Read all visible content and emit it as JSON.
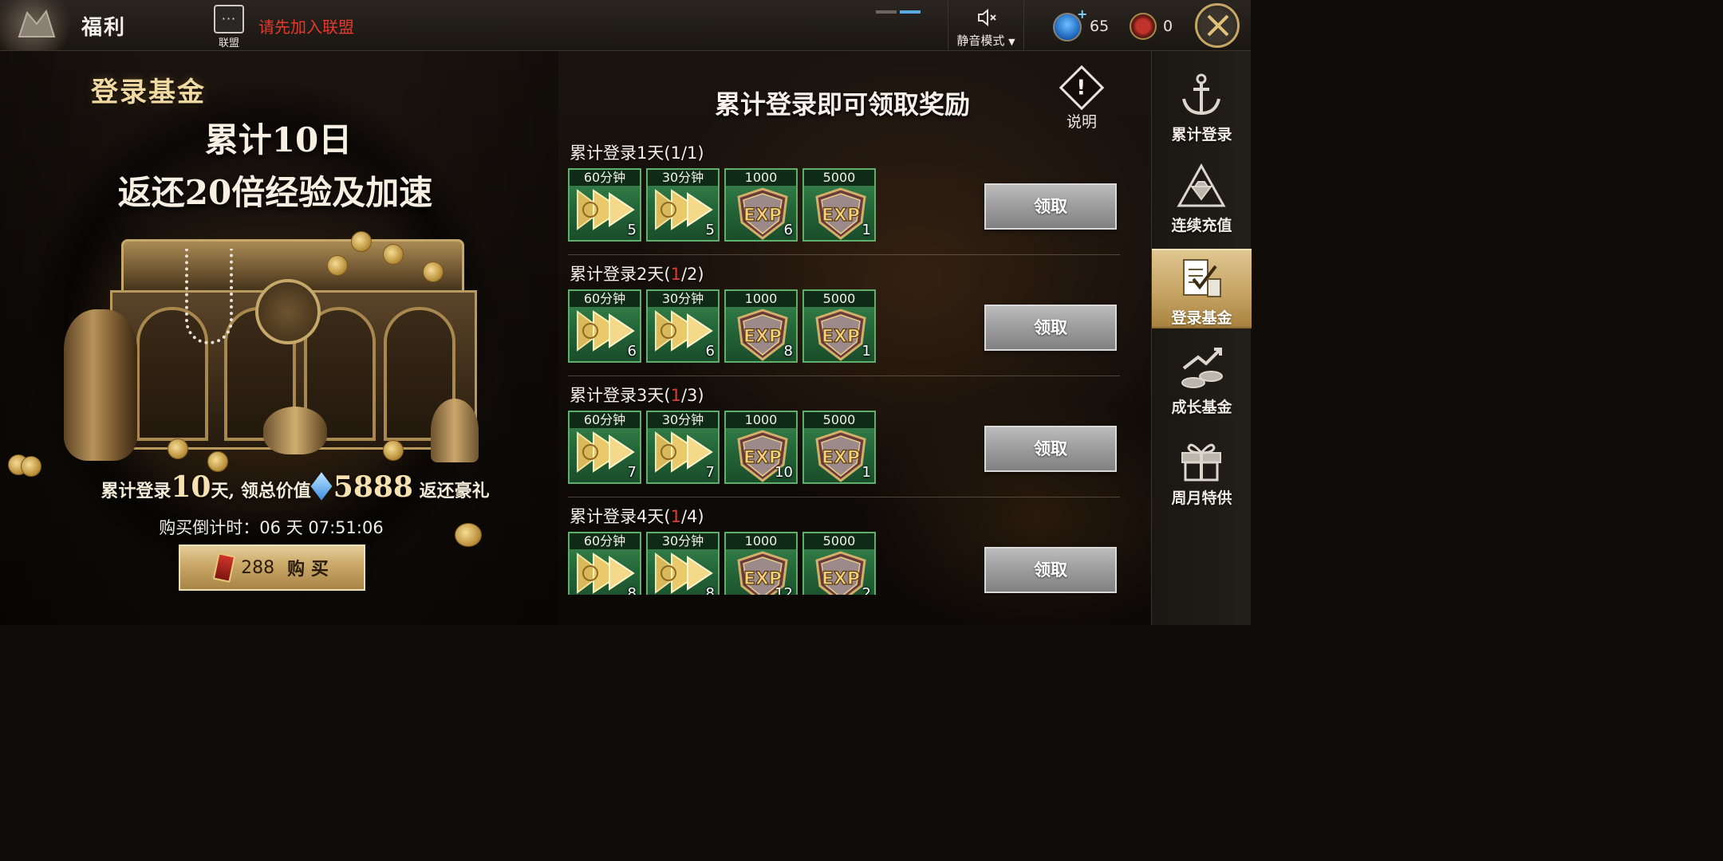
{
  "header": {
    "title": "福利",
    "alliance_label": "联盟",
    "alliance_hint": "请先加入联盟",
    "mute_label": "静音模式",
    "gem_count": "65",
    "card_count": "0"
  },
  "promo": {
    "title": "登录基金",
    "line1": "累计10日",
    "line2": "返还20倍经验及加速",
    "summary_pre": "累计登录",
    "summary_days": "10",
    "summary_mid": "天, 领总价值",
    "summary_value": "5888",
    "summary_post": "返还豪礼",
    "countdown": "购买倒计时：06 天 07:51:06",
    "buy_price": "288",
    "buy_label": "购 买"
  },
  "main": {
    "title": "累计登录即可领取奖励",
    "explain_label": "说明",
    "claim_label": "领取",
    "rows": [
      {
        "title": "累计登录1天(",
        "progress": "1",
        "total": "/1)",
        "items": [
          {
            "tag": "60分钟",
            "count": "5",
            "icon": "speedup-arrow-icon"
          },
          {
            "tag": "30分钟",
            "count": "5",
            "icon": "speedup-arrow-icon"
          },
          {
            "tag": "1000",
            "count": "6",
            "icon": "exp-shield-icon"
          },
          {
            "tag": "5000",
            "count": "1",
            "icon": "exp-shield-icon"
          }
        ]
      },
      {
        "title": "累计登录2天(",
        "progress": "1",
        "total": "/2)",
        "items": [
          {
            "tag": "60分钟",
            "count": "6",
            "icon": "speedup-arrow-icon"
          },
          {
            "tag": "30分钟",
            "count": "6",
            "icon": "speedup-arrow-icon"
          },
          {
            "tag": "1000",
            "count": "8",
            "icon": "exp-shield-icon"
          },
          {
            "tag": "5000",
            "count": "1",
            "icon": "exp-shield-icon"
          }
        ]
      },
      {
        "title": "累计登录3天(",
        "progress": "1",
        "total": "/3)",
        "items": [
          {
            "tag": "60分钟",
            "count": "7",
            "icon": "speedup-arrow-icon"
          },
          {
            "tag": "30分钟",
            "count": "7",
            "icon": "speedup-arrow-icon"
          },
          {
            "tag": "1000",
            "count": "10",
            "icon": "exp-shield-icon"
          },
          {
            "tag": "5000",
            "count": "1",
            "icon": "exp-shield-icon"
          }
        ]
      },
      {
        "title": "累计登录4天(",
        "progress": "1",
        "total": "/4)",
        "items": [
          {
            "tag": "60分钟",
            "count": "8",
            "icon": "speedup-arrow-icon"
          },
          {
            "tag": "30分钟",
            "count": "8",
            "icon": "speedup-arrow-icon"
          },
          {
            "tag": "1000",
            "count": "12",
            "icon": "exp-shield-icon"
          },
          {
            "tag": "5000",
            "count": "2",
            "icon": "exp-shield-icon"
          }
        ]
      }
    ]
  },
  "sidebar": {
    "items": [
      {
        "label": "累计登录",
        "icon": "anchor-icon",
        "active": false
      },
      {
        "label": "连续充值",
        "icon": "diamond-triangle-icon",
        "active": false
      },
      {
        "label": "登录基金",
        "icon": "fund-document-icon",
        "active": true
      },
      {
        "label": "成长基金",
        "icon": "growth-coins-icon",
        "active": false
      },
      {
        "label": "周月特供",
        "icon": "gift-box-icon",
        "active": false
      }
    ]
  },
  "colors": {
    "accent_gold": "#c9a766",
    "progress_red": "#e53a2e",
    "item_green": "#25683a",
    "alliance_hint_red": "#e23a2c"
  }
}
